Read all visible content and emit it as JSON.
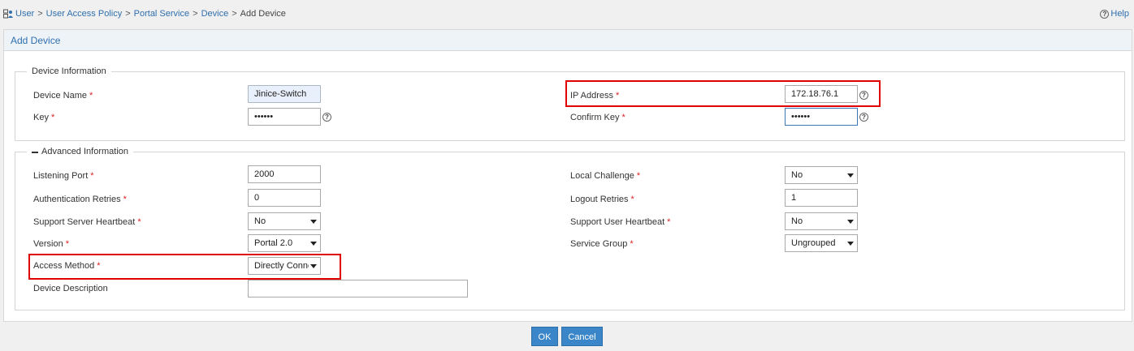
{
  "breadcrumb": {
    "items": [
      "User",
      "User Access Policy",
      "Portal Service",
      "Device"
    ],
    "current": "Add Device",
    "separator": ">"
  },
  "help": {
    "label": "Help",
    "glyph": "?"
  },
  "panel": {
    "title": "Add Device"
  },
  "device_info": {
    "legend": "Device Information",
    "device_name": {
      "label": "Device Name",
      "value": "Jinice-Switch"
    },
    "key": {
      "label": "Key",
      "value": "••••••"
    },
    "ip_address": {
      "label": "IP Address",
      "value": "172.18.76.1"
    },
    "confirm_key": {
      "label": "Confirm Key",
      "value": "••••••"
    }
  },
  "advanced_info": {
    "legend": "Advanced Information",
    "listening_port": {
      "label": "Listening Port",
      "value": "2000"
    },
    "auth_retries": {
      "label": "Authentication Retries",
      "value": "0"
    },
    "server_heartbeat": {
      "label": "Support Server Heartbeat",
      "value": "No"
    },
    "version": {
      "label": "Version",
      "value": "Portal 2.0"
    },
    "access_method": {
      "label": "Access Method",
      "value": "Directly Connected"
    },
    "device_description": {
      "label": "Device Description",
      "value": ""
    },
    "local_challenge": {
      "label": "Local Challenge",
      "value": "No"
    },
    "logout_retries": {
      "label": "Logout Retries",
      "value": "1"
    },
    "user_heartbeat": {
      "label": "Support User Heartbeat",
      "value": "No"
    },
    "service_group": {
      "label": "Service Group",
      "value": "Ungrouped"
    }
  },
  "required_mark": "*",
  "buttons": {
    "ok": "OK",
    "cancel": "Cancel"
  },
  "colors": {
    "accent": "#2f6fae",
    "button": "#3a86c8",
    "required": "#dd2222",
    "highlight": "#e00000"
  }
}
